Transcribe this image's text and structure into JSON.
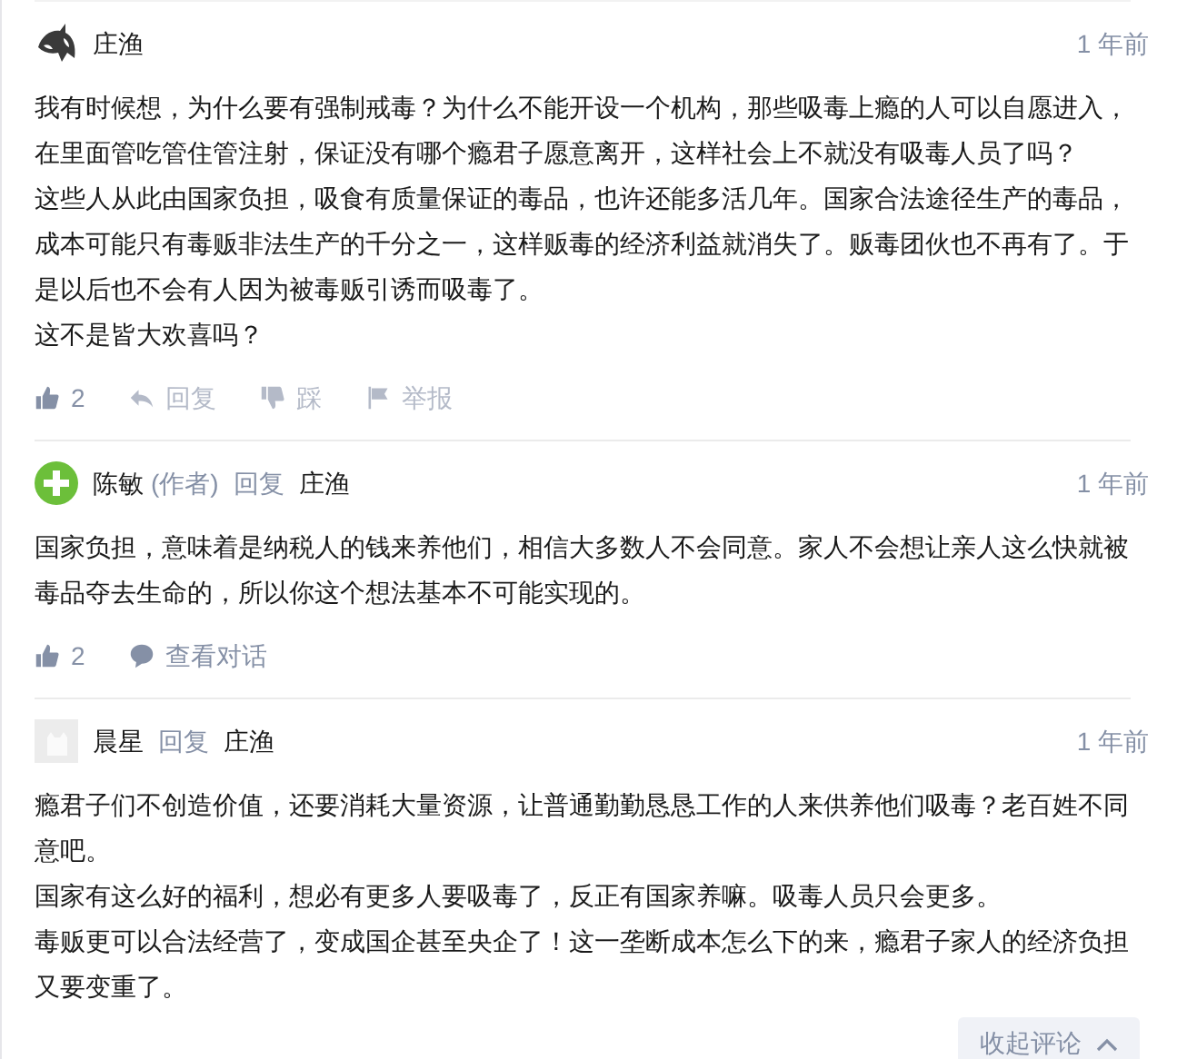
{
  "comments": [
    {
      "author": "庄渔",
      "time": "1 年前",
      "paragraphs": [
        "我有时候想，为什么要有强制戒毒？为什么不能开设一个机构，那些吸毒上瘾的人可以自愿进入，在里面管吃管住管注射，保证没有哪个瘾君子愿意离开，这样社会上不就没有吸毒人员了吗？",
        "这些人从此由国家负担，吸食有质量保证的毒品，也许还能多活几年。国家合法途径生产的毒品，成本可能只有毒贩非法生产的千分之一，这样贩毒的经济利益就消失了。贩毒团伙也不再有了。于是以后也不会有人因为被毒贩引诱而吸毒了。",
        "这不是皆大欢喜吗？"
      ],
      "actions": [
        {
          "kind": "like",
          "label": "2",
          "dimmed": false
        },
        {
          "kind": "reply",
          "label": "回复",
          "dimmed": true
        },
        {
          "kind": "dislike",
          "label": "踩",
          "dimmed": true
        },
        {
          "kind": "report",
          "label": "举报",
          "dimmed": true
        }
      ]
    },
    {
      "author": "陈敏",
      "author_tag": "(作者)",
      "reply_word": "回复",
      "reply_to": "庄渔",
      "time": "1 年前",
      "paragraphs": [
        "国家负担，意味着是纳税人的钱来养他们，相信大多数人不会同意。家人不会想让亲人这么快就被毒品夺去生命的，所以你这个想法基本不可能实现的。"
      ],
      "actions": [
        {
          "kind": "like",
          "label": "2",
          "dimmed": false
        },
        {
          "kind": "conversation",
          "label": "查看对话",
          "dimmed": false
        }
      ]
    },
    {
      "author": "晨星",
      "reply_word": "回复",
      "reply_to": "庄渔",
      "time": "1 年前",
      "paragraphs": [
        "瘾君子们不创造价值，还要消耗大量资源，让普通勤勤恳恳工作的人来供养他们吸毒？老百姓不同意吧。",
        "国家有这么好的福利，想必有更多人要吸毒了，反正有国家养嘛。吸毒人员只会更多。",
        "毒贩更可以合法经营了，变成国企甚至央企了！这一垄断成本怎么下的来，瘾君子家人的经济负担又要变重了。"
      ]
    }
  ],
  "collapse_button": {
    "label": "收起评论"
  }
}
